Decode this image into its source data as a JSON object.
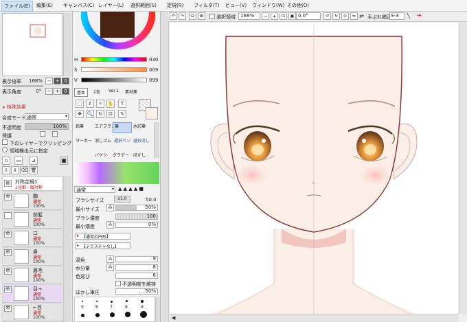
{
  "menu": [
    "ファイル(E)",
    "編集(E)",
    "キャンバス(C)",
    "レイヤー(L)",
    "選択範囲(S)",
    "定規(R)",
    "フィルタ(T)",
    "ビュー(V)",
    "ウィンドウ(W)",
    "その他(O)"
  ],
  "navigator": {
    "zoom_label": "表示倍率",
    "zoom_value": "168%",
    "angle_label": "表示角度",
    "angle_value": "0°"
  },
  "effects": {
    "header": "特殊効果",
    "blend_label": "合成モード",
    "blend_value": "通常",
    "opacity_label": "不透明度",
    "opacity_value": "100%",
    "protect_label": "保護",
    "clip_label": "下のレイヤーでクリッピング",
    "select_src_label": "領域検出元に指定"
  },
  "layers": [
    {
      "name": "対称定規1",
      "mode": "1分割 - 縦対称",
      "opacity": ""
    },
    {
      "name": "胸",
      "mode": "通常",
      "opacity": "100%"
    },
    {
      "name": "前髪",
      "mode": "通常",
      "opacity": "100%"
    },
    {
      "name": "口",
      "mode": "通常",
      "opacity": "100%"
    },
    {
      "name": "鼻",
      "mode": "通常",
      "opacity": "100%"
    },
    {
      "name": "眉毛",
      "mode": "通常",
      "opacity": "100%"
    },
    {
      "name": "目→",
      "mode": "通常",
      "opacity": "100%"
    },
    {
      "name": "←目",
      "mode": "通常",
      "opacity": "100%"
    }
  ],
  "color": {
    "h_label": "H",
    "h_value": "030",
    "s_label": "S",
    "s_value": "009",
    "v_label": "V",
    "v_value": "099",
    "wheel_color": "#4a2410",
    "tabs": [
      "基本",
      "2色",
      "Ver.1",
      "素材集"
    ]
  },
  "tools": {
    "row1": [
      "鉛筆",
      "エアブラシ",
      "筆",
      "水彩筆"
    ],
    "row2": [
      "マーカー",
      "消しゴム",
      "選択ペン",
      "選択消し"
    ],
    "row3": [
      "",
      "バケツ",
      "グラデー",
      "ぼかし"
    ]
  },
  "brush": {
    "mode_value": "通常",
    "size_label": "ブラシサイズ",
    "size_mult": "x1.0",
    "size_value": "50.0",
    "minsize_label": "最小サイズ",
    "minsize_value": "50%",
    "density_label": "ブラシ濃度",
    "density_value": "100",
    "mindensity_label": "最小濃度",
    "mindensity_value": "0%",
    "shape_value": "【通常の円形】",
    "texture_value": "【テクスチャなし】",
    "blend_label": "混色",
    "blend_value": "9",
    "water_label": "水分量",
    "water_value": "8",
    "hold_label": "色延び",
    "hold_value": "6",
    "keep_opacity_label": "不透明度を維持",
    "blur_label": "ぼかし筆圧",
    "blur_value": "... 50%",
    "dot_sizes": [
      "5",
      "6",
      "7",
      "8",
      "9"
    ]
  },
  "canvas_toolbar": {
    "selection_label": "選択領域",
    "zoom_value": "168%",
    "angle_value": "0.0°",
    "stabilizer_label": "手ぶれ補正",
    "stabilizer_value": "S-3"
  },
  "colors": {
    "skin": "#fcefe7",
    "line": "#8a2b2b",
    "accent_red": "#d2363a",
    "select_highlight": "#cfe3f7"
  }
}
